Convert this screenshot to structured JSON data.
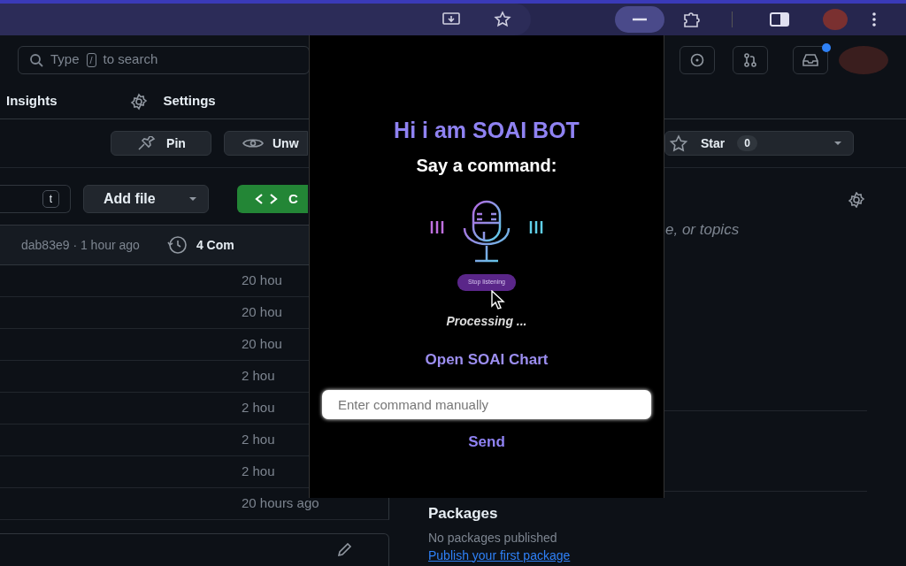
{
  "browser": {
    "extension_active": true
  },
  "header": {
    "search": {
      "prefix": "Type",
      "key": "/",
      "suffix": "to search"
    },
    "inbox_unread": true
  },
  "repo_nav": [
    {
      "label": "Insights",
      "kind": "text"
    },
    {
      "label": "Settings",
      "kind": "settings"
    }
  ],
  "repo_actions": {
    "pin": "Pin",
    "watch": "Unw",
    "star": "Star",
    "star_count": "0"
  },
  "file_toolbar": {
    "go_to_file_key": "t",
    "add_file": "Add file",
    "code": "C"
  },
  "commit_bar": {
    "commit": "dab83e9 · 1 hour ago",
    "commits": "4 Com"
  },
  "files": [
    {
      "time": "20 hou"
    },
    {
      "time": "20 hou"
    },
    {
      "time": "20 hou"
    },
    {
      "time": "2 hou"
    },
    {
      "time": "2 hou"
    },
    {
      "time": "2 hou"
    },
    {
      "time": "2 hou"
    },
    {
      "time": "20 hours ago"
    }
  ],
  "about": {
    "description_tail": "e, or topics"
  },
  "packages": {
    "title": "Packages",
    "empty": "No packages published",
    "link": "Publish your first package"
  },
  "bot": {
    "greeting": "Hi i am SOAI BOT",
    "prompt": "Say a command:",
    "listening": true,
    "listen_button": "Stop listening",
    "status": "Processing ...",
    "chart_link": "Open SOAI Chart",
    "command_input": {
      "placeholder": "Enter command manually"
    },
    "send": "Send"
  }
}
